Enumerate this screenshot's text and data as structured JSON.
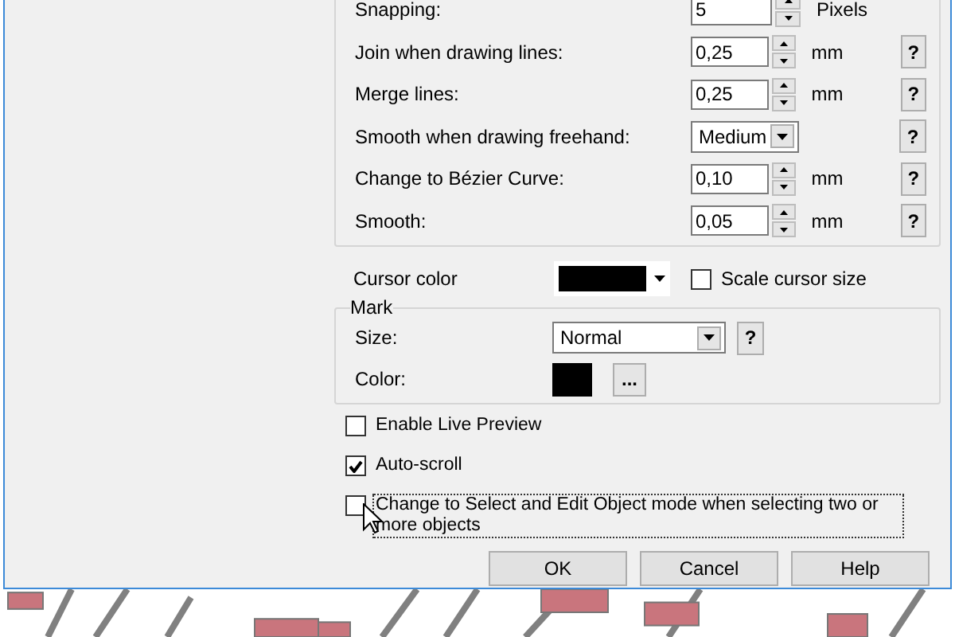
{
  "settings": [
    {
      "label": "Snapping:",
      "kind": "spin",
      "value": "5",
      "unit": "Pixels"
    },
    {
      "label": "Join when drawing lines:",
      "kind": "spin",
      "value": "0,25",
      "unit": "mm",
      "help": "?"
    },
    {
      "label": "Merge lines:",
      "kind": "spin",
      "value": "0,25",
      "unit": "mm",
      "help": "?"
    },
    {
      "label": "Smooth when drawing freehand:",
      "kind": "select",
      "value": "Medium",
      "help": "?"
    },
    {
      "label": "Change to Bézier Curve:",
      "kind": "spin",
      "value": "0,10",
      "unit": "mm",
      "help": "?"
    },
    {
      "label": "Smooth:",
      "kind": "spin",
      "value": "0,05",
      "unit": "mm",
      "help": "?"
    }
  ],
  "cursor": {
    "label": "Cursor color",
    "color": "#000000",
    "scale": {
      "label": "Scale cursor size",
      "checked": false
    }
  },
  "mark": {
    "title": "Mark",
    "size_label": "Size:",
    "size_value": "Normal",
    "help": "?",
    "color_label": "Color:",
    "color": "#000000",
    "browse": "..."
  },
  "options": [
    {
      "label": "Enable Live Preview",
      "checked": false,
      "focused": false
    },
    {
      "label": "Auto-scroll",
      "checked": true,
      "focused": false
    },
    {
      "label": "Change to Select and Edit Object mode when selecting two or more objects",
      "checked": false,
      "focused": true
    }
  ],
  "buttons": [
    "OK",
    "Cancel",
    "Help"
  ]
}
